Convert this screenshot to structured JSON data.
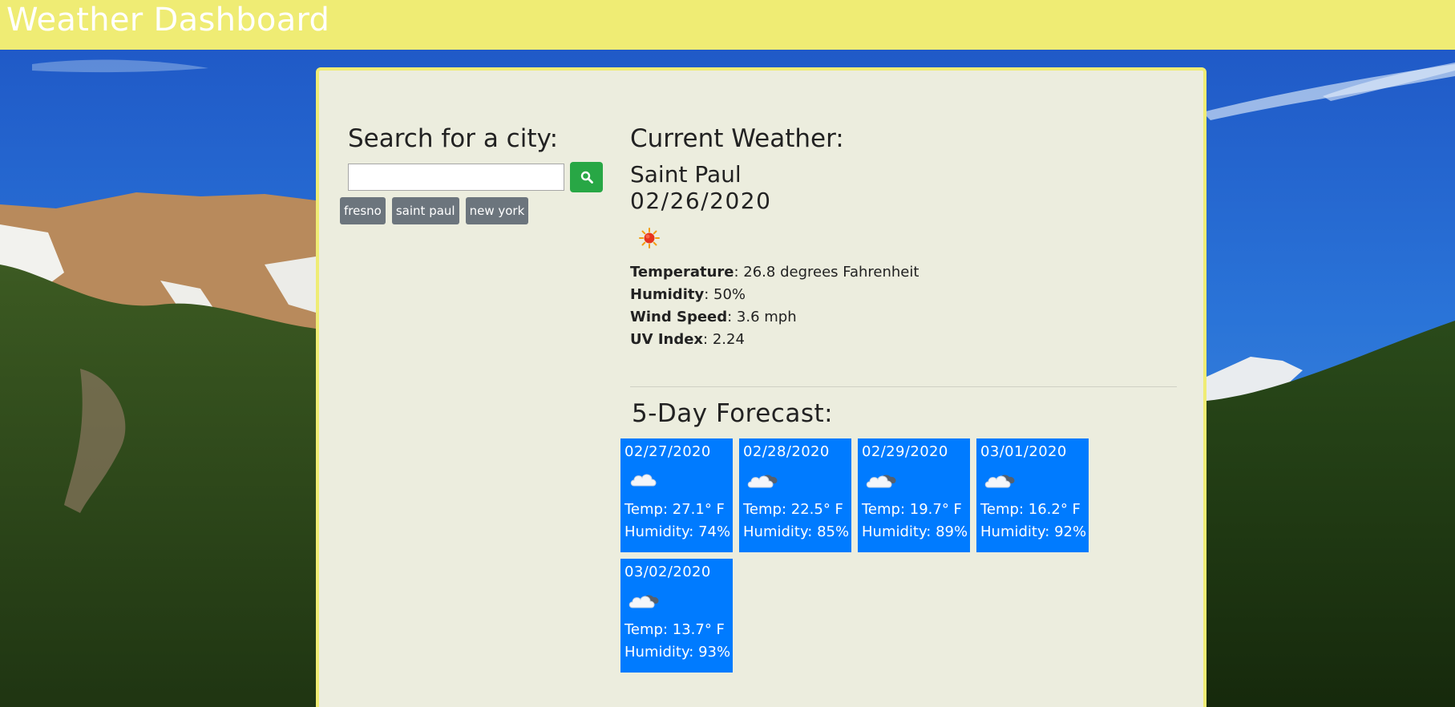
{
  "header": {
    "title": "Weather Dashboard"
  },
  "search": {
    "heading": "Search for a city:",
    "input_value": "",
    "button_icon": "search-icon",
    "history": [
      "fresno",
      "saint paul",
      "new york"
    ]
  },
  "current": {
    "heading": "Current Weather:",
    "city": "Saint Paul",
    "date": "02/26/2020",
    "icon": "sun-icon",
    "temperature_label": "Temperature",
    "temperature_value": ": 26.8 degrees Fahrenheit",
    "humidity_label": "Humidity",
    "humidity_value": ": 50%",
    "wind_label": "Wind Speed",
    "wind_value": ": 3.6 mph",
    "uv_label": "UV Index",
    "uv_value": ": 2.24"
  },
  "forecast": {
    "heading": "5-Day Forecast:",
    "days": [
      {
        "date": "02/27/2020",
        "icon": "cloud-icon",
        "temp": "Temp: 27.1° F",
        "humidity": "Humidity: 74%"
      },
      {
        "date": "02/28/2020",
        "icon": "cloudy-icon",
        "temp": "Temp: 22.5° F",
        "humidity": "Humidity: 85%"
      },
      {
        "date": "02/29/2020",
        "icon": "cloudy-icon",
        "temp": "Temp: 19.7° F",
        "humidity": "Humidity: 89%"
      },
      {
        "date": "03/01/2020",
        "icon": "cloudy-icon",
        "temp": "Temp: 16.2° F",
        "humidity": "Humidity: 92%"
      },
      {
        "date": "03/02/2020",
        "icon": "cloudy-icon",
        "temp": "Temp: 13.7° F",
        "humidity": "Humidity: 93%"
      }
    ]
  },
  "colors": {
    "header_bg": "#efec74",
    "panel_bg": "#ecedde",
    "search_button": "#28a745",
    "history_button": "#6c757d",
    "forecast_card": "#007bff"
  }
}
